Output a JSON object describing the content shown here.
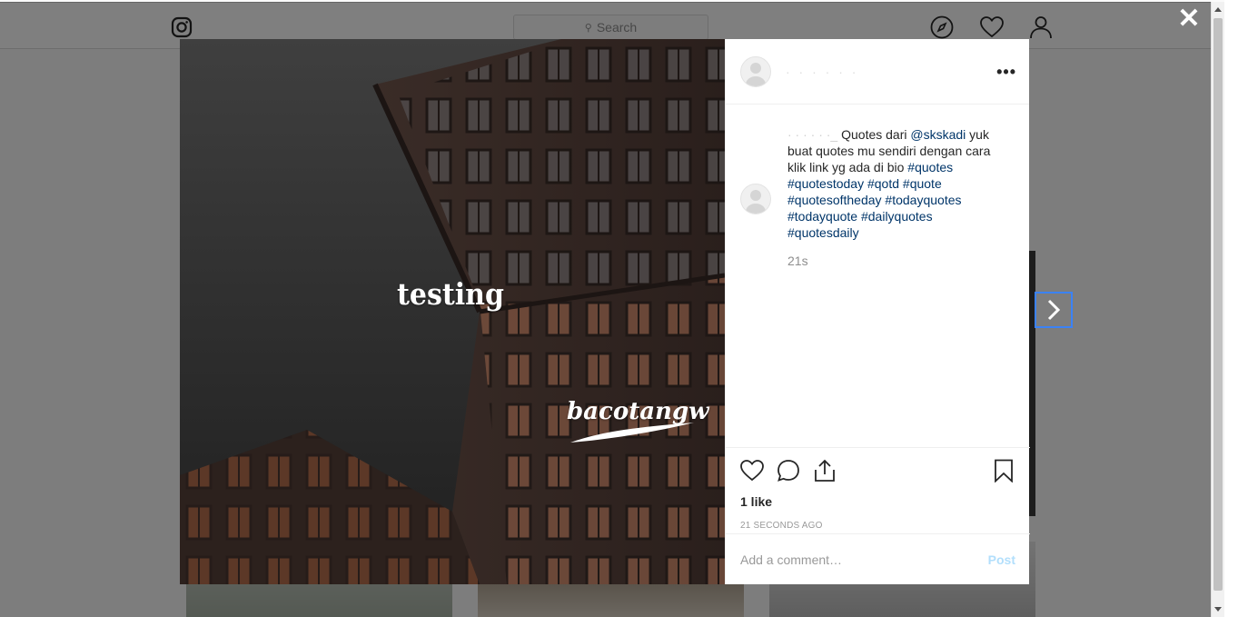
{
  "topbar": {
    "logo_icon": "instagram-icon",
    "search_placeholder": "Search",
    "nav_icons": [
      "compass-icon",
      "heart-icon",
      "profile-icon"
    ]
  },
  "modal": {
    "close_label": "✕",
    "next_icon": "chevron-right-icon",
    "photo": {
      "text_top": "testing",
      "text_watermark": "bacotangw"
    },
    "header": {
      "username_blurred": "· · · · · ·",
      "more_label": "•••"
    },
    "caption": {
      "blurred_prefix": "· · · · · ·_",
      "text_before_mention": " Quotes dari ",
      "mention": "@skskadi",
      "body": " yuk buat quotes mu sendiri dengan cara klik link yg ada di bio ",
      "hashtags": [
        "#quotes",
        "#quotestoday",
        "#qotd",
        "#quote",
        "#quotesoftheday",
        "#todayquotes",
        "#todayquote",
        "#dailyquotes",
        "#quotesdaily"
      ],
      "time_relative": "21s"
    },
    "actions": {
      "likes": "1 like",
      "date": "21 SECONDS AGO"
    },
    "comment": {
      "placeholder": "Add a comment…",
      "post_label": "Post"
    }
  },
  "colors": {
    "link": "#003569",
    "post_disabled": "#b2dffc",
    "focus_outline": "#3b82f6"
  }
}
